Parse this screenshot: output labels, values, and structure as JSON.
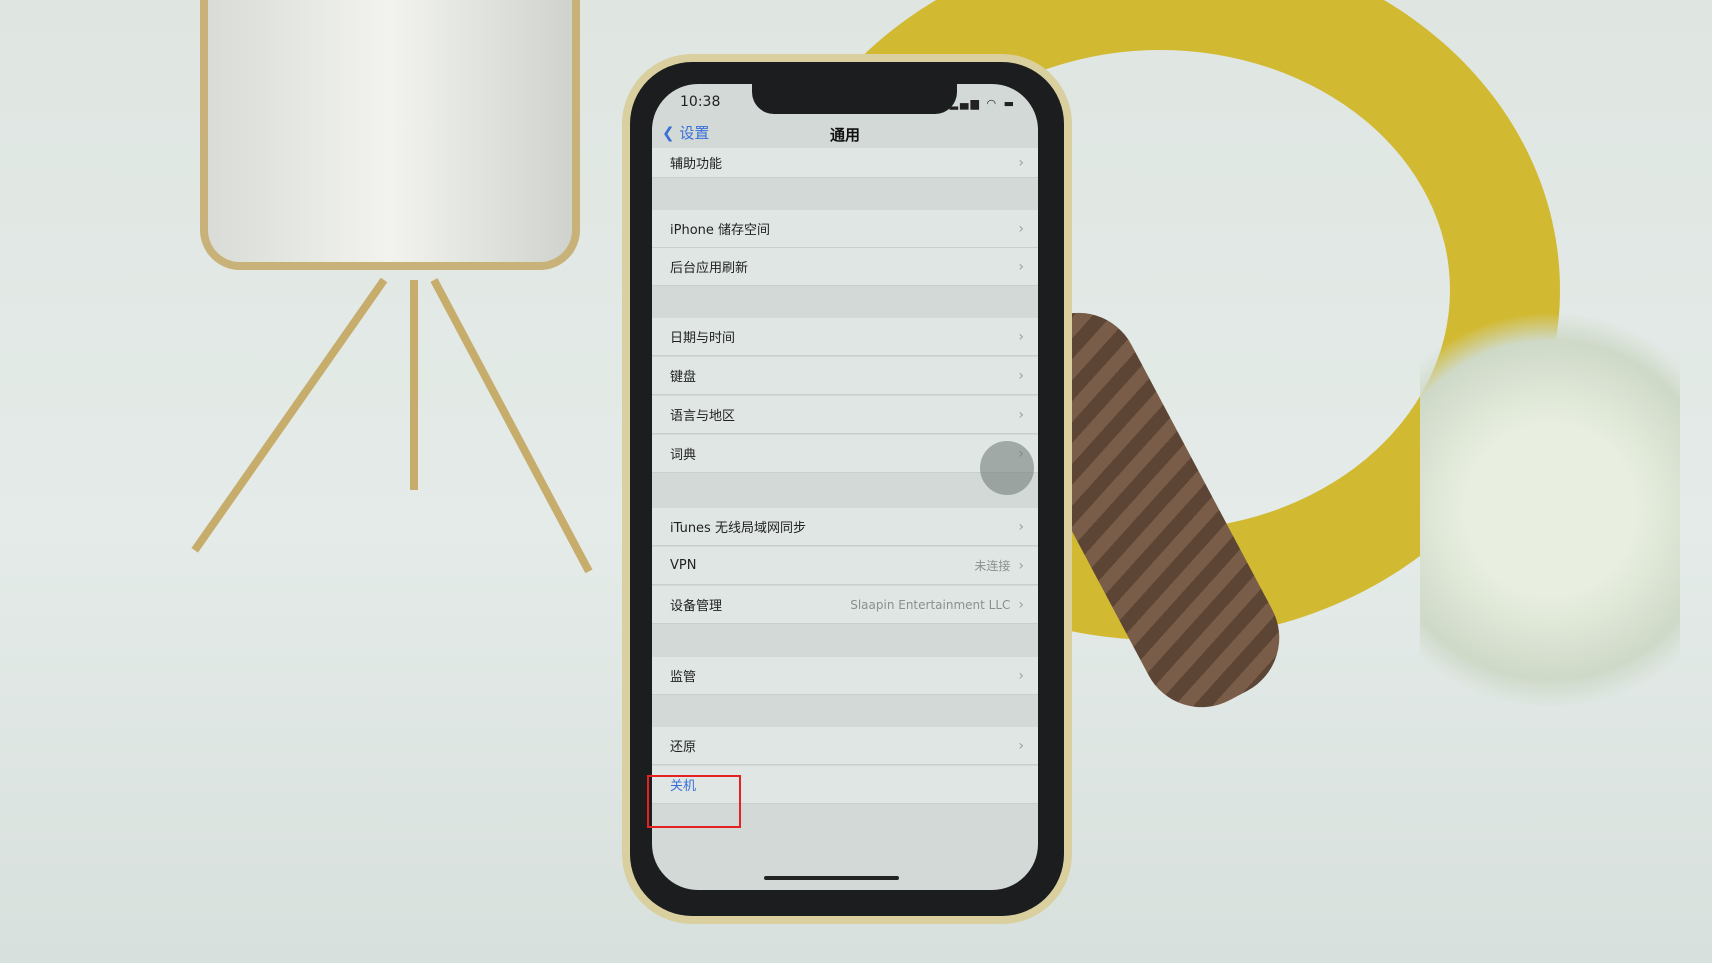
{
  "status": {
    "time": "10:38",
    "icons": [
      "signal-icon",
      "wifi-icon",
      "battery-icon"
    ]
  },
  "nav": {
    "back_label": "设置",
    "title": "通用"
  },
  "rows": [
    {
      "label": "辅助功能"
    },
    {
      "label": "iPhone 储存空间"
    },
    {
      "label": "后台应用刷新"
    },
    {
      "label": "日期与时间"
    },
    {
      "label": "键盘"
    },
    {
      "label": "语言与地区"
    },
    {
      "label": "词典"
    },
    {
      "label": "iTunes 无线局域网同步"
    },
    {
      "label": "VPN",
      "value": "未连接"
    },
    {
      "label": "设备管理",
      "value": "Slaapin Entertainment LLC"
    },
    {
      "label": "监管"
    },
    {
      "label": "还原"
    },
    {
      "label": "关机"
    }
  ],
  "colors": {
    "accent": "#3b6fd8",
    "highlight": "#e52222"
  }
}
